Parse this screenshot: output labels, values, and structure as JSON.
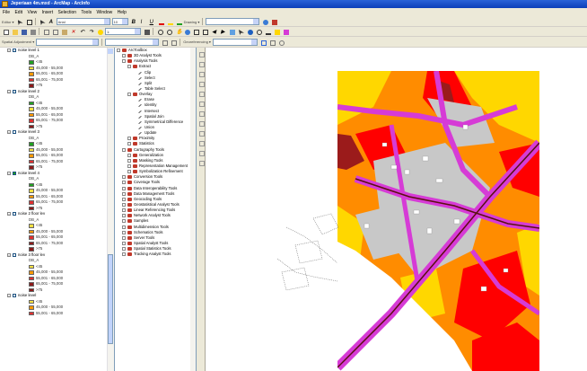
{
  "window": {
    "title": "Jeperiaan 4m.mxd - ArcMap - ArcInfo"
  },
  "menu": [
    "File",
    "Edit",
    "View",
    "Insert",
    "Selection",
    "Tools",
    "Window",
    "Help"
  ],
  "toolbar": {
    "editor_label": "Editor ▾",
    "scale_value": "1:",
    "font_value": "Arial",
    "size_value": "10",
    "drawing_label": "Drawing ▾",
    "spatial_adjustment_label": "Spatial Adjustment ▾",
    "georef_label": "Georeferencing ▾"
  },
  "colors": {
    "accent": "#2a63d8",
    "map_background": "#ffffff",
    "zone_dark": "#9b1b1b",
    "zone_red": "#ff0000",
    "zone_orange": "#ff8c00",
    "zone_yellow": "#ffd700",
    "roads": "#d63bd6",
    "buildings": "#c0c0c0"
  },
  "toc": {
    "layers": [
      {
        "name": "noise level 1",
        "checked": false,
        "field": "DB_A",
        "classes": [
          "<45",
          "45,000 - 55,000",
          "55,001 - 65,000",
          "65,001 - 75,000",
          ">75"
        ],
        "colors": [
          "#21a121",
          "#f5e042",
          "#ff9900",
          "#e03030",
          "#8b1a1a"
        ]
      },
      {
        "name": "noise level 2",
        "checked": false,
        "field": "DB_A",
        "classes": [
          "<45",
          "45,000 - 55,000",
          "55,001 - 65,000",
          "65,001 - 75,000",
          ">75"
        ],
        "colors": [
          "#21a121",
          "#f5e042",
          "#ff9900",
          "#e03030",
          "#8b1a1a"
        ]
      },
      {
        "name": "noise level 3",
        "checked": false,
        "field": "DB_A",
        "classes": [
          "<45",
          "45,000 - 55,000",
          "55,001 - 65,000",
          "65,001 - 75,000",
          ">75"
        ],
        "colors": [
          "#21a121",
          "#f5e042",
          "#ff9900",
          "#e03030",
          "#8b1a1a"
        ]
      },
      {
        "name": "noise level 4",
        "checked": true,
        "field": "DB_A",
        "classes": [
          "<45",
          "45,000 - 55,000",
          "55,001 - 65,000",
          "65,001 - 75,000",
          ">75"
        ],
        "colors": [
          "#21a121",
          "#f5e042",
          "#ff9900",
          "#e03030",
          "#8b1a1a"
        ]
      },
      {
        "name": "noise 2 floor lev",
        "checked": false,
        "field": "DB_A",
        "classes": [
          "<45",
          "45,000 - 55,000",
          "55,001 - 65,000",
          "65,001 - 75,000",
          ">75"
        ],
        "colors": [
          "#f5e042",
          "#ff9900",
          "#e03030",
          "#8b1a1a",
          "#8b1a1a"
        ]
      },
      {
        "name": "noise 3 floor lev",
        "checked": false,
        "field": "DB_A",
        "classes": [
          "<45",
          "45,000 - 55,000",
          "55,001 - 65,000",
          "65,001 - 75,000",
          ">75"
        ],
        "colors": [
          "#f5e042",
          "#ff9900",
          "#e03030",
          "#8b1a1a",
          "#8b1a1a"
        ]
      },
      {
        "name": "noise level",
        "checked": false,
        "field": "",
        "classes": [
          "<45",
          "45,000 - 55,000",
          "55,001 - 65,000"
        ],
        "colors": [
          "#f5e042",
          "#ff9900",
          "#e03030"
        ]
      }
    ]
  },
  "arctoolbox": {
    "items": [
      {
        "level": 0,
        "label": "ArcToolbox",
        "icon": "toolbox-icon",
        "expand": "-"
      },
      {
        "level": 1,
        "label": "3D Analyst Tools",
        "icon": "toolbox-icon",
        "expand": "+"
      },
      {
        "level": 1,
        "label": "Analysis Tools",
        "icon": "toolbox-icon",
        "expand": "-"
      },
      {
        "level": 2,
        "label": "Extract",
        "icon": "toolset-icon",
        "expand": "-"
      },
      {
        "level": 3,
        "label": "Clip",
        "icon": "tool-icon",
        "expand": ""
      },
      {
        "level": 3,
        "label": "Select",
        "icon": "tool-icon",
        "expand": ""
      },
      {
        "level": 3,
        "label": "Split",
        "icon": "tool-icon",
        "expand": ""
      },
      {
        "level": 3,
        "label": "Table Select",
        "icon": "tool-icon",
        "expand": ""
      },
      {
        "level": 2,
        "label": "Overlay",
        "icon": "toolset-icon",
        "expand": "-"
      },
      {
        "level": 3,
        "label": "Erase",
        "icon": "tool-icon",
        "expand": ""
      },
      {
        "level": 3,
        "label": "Identity",
        "icon": "tool-icon",
        "expand": ""
      },
      {
        "level": 3,
        "label": "Intersect",
        "icon": "tool-icon",
        "expand": ""
      },
      {
        "level": 3,
        "label": "Spatial Join",
        "icon": "tool-icon",
        "expand": ""
      },
      {
        "level": 3,
        "label": "Symmetrical Difference",
        "icon": "tool-icon",
        "expand": ""
      },
      {
        "level": 3,
        "label": "Union",
        "icon": "tool-icon",
        "expand": ""
      },
      {
        "level": 3,
        "label": "Update",
        "icon": "tool-icon",
        "expand": ""
      },
      {
        "level": 2,
        "label": "Proximity",
        "icon": "toolset-icon",
        "expand": "+"
      },
      {
        "level": 2,
        "label": "Statistics",
        "icon": "toolset-icon",
        "expand": "+"
      },
      {
        "level": 1,
        "label": "Cartography Tools",
        "icon": "toolbox-icon",
        "expand": "-"
      },
      {
        "level": 2,
        "label": "Generalization",
        "icon": "toolset-icon",
        "expand": "+"
      },
      {
        "level": 2,
        "label": "Masking Tools",
        "icon": "toolset-icon",
        "expand": "+"
      },
      {
        "level": 2,
        "label": "Representation Management",
        "icon": "toolset-icon",
        "expand": "+"
      },
      {
        "level": 2,
        "label": "Symbolization Refinement",
        "icon": "toolset-icon",
        "expand": "+"
      },
      {
        "level": 1,
        "label": "Conversion Tools",
        "icon": "toolbox-icon",
        "expand": "+"
      },
      {
        "level": 1,
        "label": "Coverage Tools",
        "icon": "toolbox-icon",
        "expand": "+"
      },
      {
        "level": 1,
        "label": "Data Interoperability Tools",
        "icon": "toolbox-icon",
        "expand": "+"
      },
      {
        "level": 1,
        "label": "Data Management Tools",
        "icon": "toolbox-icon",
        "expand": "+"
      },
      {
        "level": 1,
        "label": "Geocoding Tools",
        "icon": "toolbox-icon",
        "expand": "+"
      },
      {
        "level": 1,
        "label": "Geostatistical Analyst Tools",
        "icon": "toolbox-icon",
        "expand": "+"
      },
      {
        "level": 1,
        "label": "Linear Referencing Tools",
        "icon": "toolbox-icon",
        "expand": "+"
      },
      {
        "level": 1,
        "label": "Network Analyst Tools",
        "icon": "toolbox-icon",
        "expand": "+"
      },
      {
        "level": 1,
        "label": "Samples",
        "icon": "toolbox-icon",
        "expand": "+"
      },
      {
        "level": 1,
        "label": "Multidimension Tools",
        "icon": "toolbox-icon",
        "expand": "+"
      },
      {
        "level": 1,
        "label": "Schematics Tools",
        "icon": "toolbox-icon",
        "expand": "+"
      },
      {
        "level": 1,
        "label": "Server Tools",
        "icon": "toolbox-icon",
        "expand": "+"
      },
      {
        "level": 1,
        "label": "Spatial Analyst Tools",
        "icon": "toolbox-icon",
        "expand": "+"
      },
      {
        "level": 1,
        "label": "Spatial Statistics Tools",
        "icon": "toolbox-icon",
        "expand": "+"
      },
      {
        "level": 1,
        "label": "Tracking Analyst Tools",
        "icon": "toolbox-icon",
        "expand": "+"
      }
    ]
  }
}
